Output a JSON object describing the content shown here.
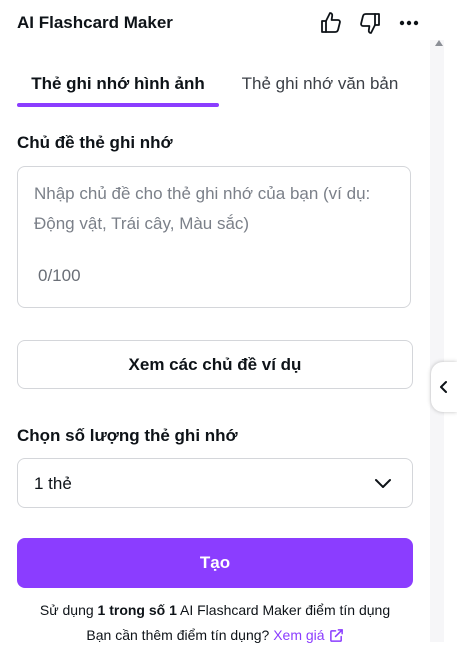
{
  "header": {
    "title": "AI Flashcard Maker",
    "like_icon": "thumbs-up-icon",
    "dislike_icon": "thumbs-down-icon",
    "more_icon": "more-horizontal-icon"
  },
  "tabs": [
    {
      "label": "Thẻ ghi nhớ hình ảnh",
      "active": true
    },
    {
      "label": "Thẻ ghi nhớ văn bản",
      "active": false
    }
  ],
  "topic": {
    "label": "Chủ đề thẻ ghi nhớ",
    "placeholder": "Nhập chủ đề cho thẻ ghi nhớ của bạn (ví dụ: Động vật, Trái cây, Màu sắc)",
    "value": "",
    "char_count": "0/100"
  },
  "examples_button": "Xem các chủ đề ví dụ",
  "count": {
    "label": "Chọn số lượng thẻ ghi nhớ",
    "selected": "1 thẻ"
  },
  "create_button": "Tạo",
  "usage": {
    "prefix": "Sử dụng ",
    "bold": "1 trong số 1",
    "suffix": " AI Flashcard Maker điểm tín dụng"
  },
  "need_more": {
    "text": "Bạn cần thêm điểm tín dụng? ",
    "link": "Xem giá"
  },
  "colors": {
    "accent": "#8b3dff",
    "text": "#0e1318",
    "border": "#d4d6da"
  }
}
